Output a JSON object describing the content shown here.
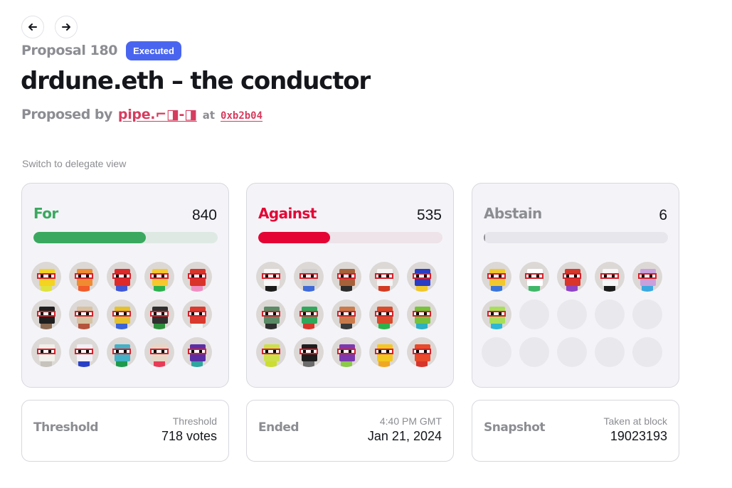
{
  "header": {
    "proposal_number": "Proposal 180",
    "status_badge": "Executed",
    "title": "drdune.eth – the conductor",
    "proposed_by_label": "Proposed by",
    "proposer": "pipe.⌐◨-◨",
    "at_label": "at",
    "tx_hash": "0xb2b04"
  },
  "switch_view_label": "Switch to delegate view",
  "colors": {
    "for": "#3aa95f",
    "for_track": "#dfe9e4",
    "against": "#e40535",
    "against_track": "#ede3e8",
    "abstain": "#8c8d92",
    "abstain_track": "#e6e6ec",
    "badge": "#4965f0",
    "link": "#d63c5e"
  },
  "votes": {
    "for": {
      "label": "For",
      "count": "840",
      "fraction": 0.61,
      "avatars": [
        {
          "head": "#f5d321",
          "body": "#dfe33d"
        },
        {
          "head": "#f08b32",
          "body": "#f25b2a"
        },
        {
          "head": "#dc2a2a",
          "body": "#3e57d6"
        },
        {
          "head": "#f6c82d",
          "body": "#2bb14e"
        },
        {
          "head": "#d9342a",
          "body": "#f08ec2"
        },
        {
          "head": "#1f1f1f",
          "body": "#8a6a52"
        },
        {
          "head": "#d6c1a0",
          "body": "#b5533c"
        },
        {
          "head": "#e3c12c",
          "body": "#3a63d8"
        },
        {
          "head": "#2f2f2f",
          "body": "#2c8f3b"
        },
        {
          "head": "#d93a2d",
          "body": "#f5f5f5"
        },
        {
          "head": "#f1efe9",
          "body": "#c6c2bc"
        },
        {
          "head": "#f2f0f6",
          "body": "#2840c8"
        },
        {
          "head": "#43b1c6",
          "body": "#1d9a4c"
        },
        {
          "head": "#e7d6c5",
          "body": "#e73b57"
        },
        {
          "head": "#5a2fa6",
          "body": "#2fa6a0"
        }
      ]
    },
    "against": {
      "label": "Against",
      "count": "535",
      "fraction": 0.39,
      "avatars": [
        {
          "head": "#f7f7f7",
          "body": "#1b1b1b"
        },
        {
          "head": "#cfcfcf",
          "body": "#3f6ad8"
        },
        {
          "head": "#a6613a",
          "body": "#2c2c2c"
        },
        {
          "head": "#f4f4f4",
          "body": "#d33b22"
        },
        {
          "head": "#2a3cc4",
          "body": "#f0c82a"
        },
        {
          "head": "#5a8a66",
          "body": "#2e2e2e"
        },
        {
          "head": "#2fa85c",
          "body": "#d8362b"
        },
        {
          "head": "#c97a4b",
          "body": "#3a3a3a"
        },
        {
          "head": "#d84a2a",
          "body": "#2bb24d"
        },
        {
          "head": "#76c23b",
          "body": "#2bb0c4"
        },
        {
          "head": "#cde04a",
          "body": "#ccdd33"
        },
        {
          "head": "#1e1e1e",
          "body": "#6c6c6c"
        },
        {
          "head": "#7b3ab0",
          "body": "#8ac94a"
        },
        {
          "head": "#f4c821",
          "body": "#f0a822"
        },
        {
          "head": "#e84a2a",
          "body": "#d7342a"
        }
      ]
    },
    "abstain": {
      "label": "Abstain",
      "count": "6",
      "fraction": 0.0,
      "avatars": [
        {
          "head": "#f1c92e",
          "body": "#3a74d9"
        },
        {
          "head": "#ffffff",
          "body": "#3fb868"
        },
        {
          "head": "#d8352b",
          "body": "#8e44c5"
        },
        {
          "head": "#f6f6f6",
          "body": "#1b1b1b"
        },
        {
          "head": "#c9a0dc",
          "body": "#3ba9e0"
        },
        {
          "head": "#a8df5a",
          "body": "#2db7d6"
        }
      ],
      "empty_slots": 9
    }
  },
  "info": {
    "threshold": {
      "label": "Threshold",
      "sub": "Threshold",
      "value": "718 votes"
    },
    "ended": {
      "label": "Ended",
      "sub": "4:40 PM GMT",
      "value": "Jan 21, 2024"
    },
    "snapshot": {
      "label": "Snapshot",
      "sub": "Taken at block",
      "value": "19023193"
    }
  }
}
